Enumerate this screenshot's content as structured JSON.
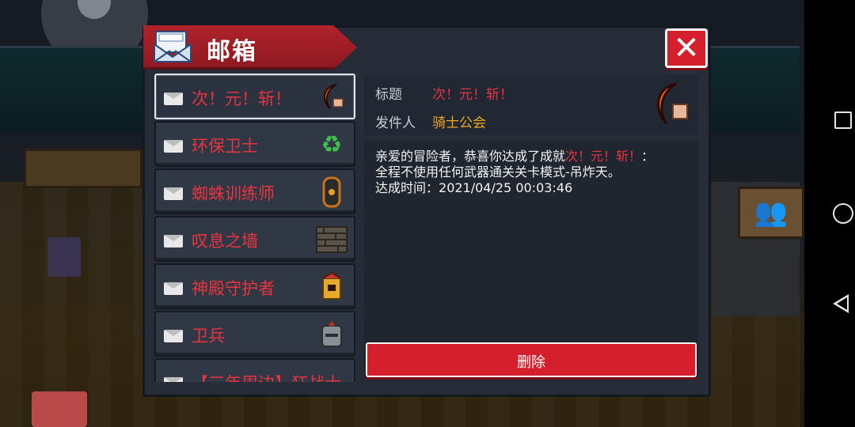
{
  "header": {
    "title": "邮箱"
  },
  "mail_list": [
    {
      "label": "次！元！斩！",
      "icon": "crescent-blade-icon",
      "selected": true
    },
    {
      "label": "环保卫士",
      "icon": "recycle-icon",
      "selected": false
    },
    {
      "label": "蜘蛛训练师",
      "icon": "spider-totem-icon",
      "selected": false
    },
    {
      "label": "叹息之墙",
      "icon": "wall-icon",
      "selected": false
    },
    {
      "label": "神殿守护者",
      "icon": "temple-guardian-icon",
      "selected": false
    },
    {
      "label": "卫兵",
      "icon": "guard-helmet-icon",
      "selected": false
    },
    {
      "label": "【三年周边】狂战士",
      "icon": "",
      "selected": false
    }
  ],
  "detail": {
    "title_label": "标题",
    "title_value": "次！元！斩！",
    "sender_label": "发件人",
    "sender_value": "骑士公会",
    "body_prefix": "亲爱的冒险者，恭喜你达成了成就",
    "body_highlight": "次！元！斩！",
    "body_colon": "：",
    "body_line2": "全程不使用任何武器通关关卡模式-吊炸天。",
    "body_time_label": "达成时间：",
    "body_time_value": "2021/04/25 00:03:46",
    "icon": "crescent-blade-icon"
  },
  "delete_button": {
    "label": "删除"
  },
  "colors": {
    "accent_red": "#d51f2d",
    "text_red": "#e9343f",
    "text_gold": "#f0a820",
    "panel": "#262d39"
  }
}
